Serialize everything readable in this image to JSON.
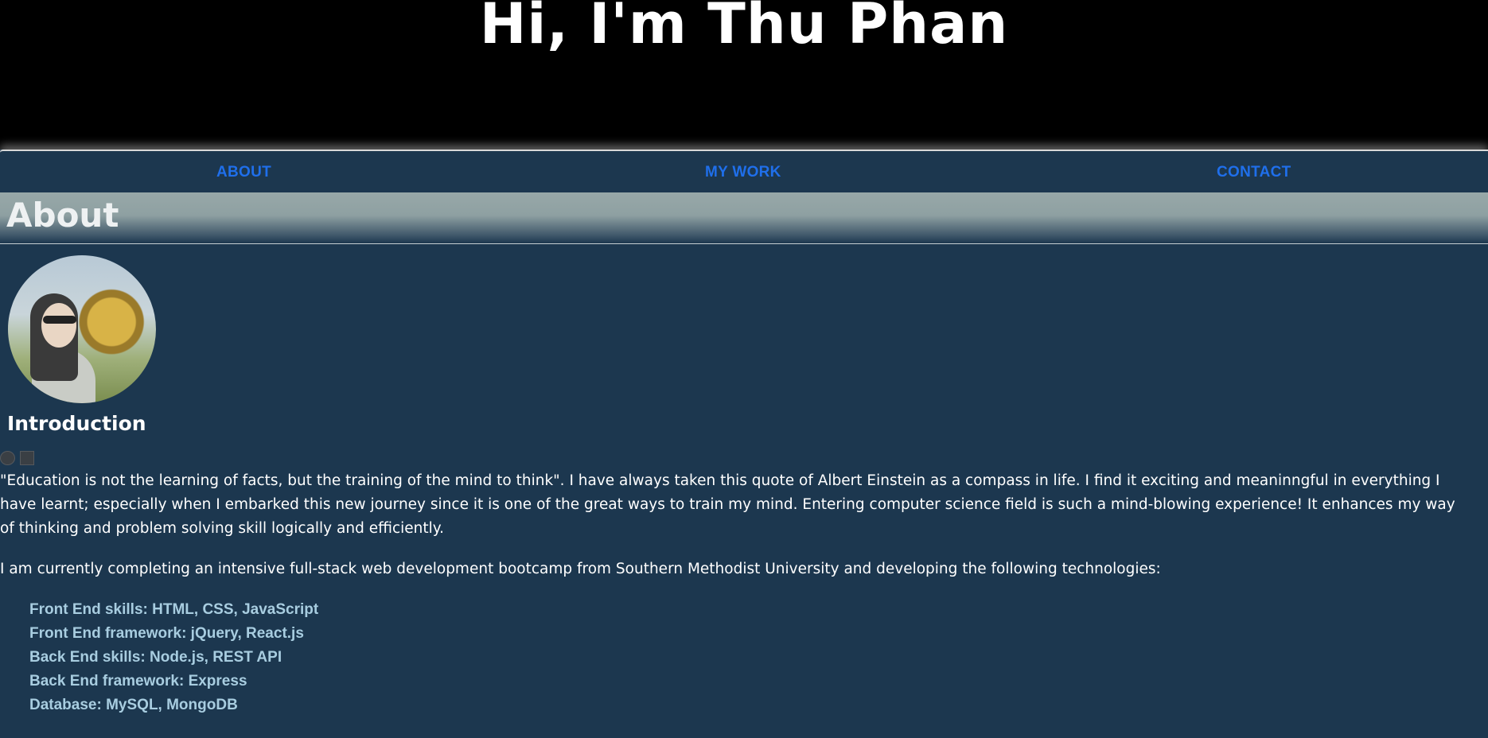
{
  "header": {
    "title": "Hi, I'm Thu Phan"
  },
  "nav": {
    "items": [
      {
        "label": "ABOUT"
      },
      {
        "label": "MY WORK"
      },
      {
        "label": "CONTACT"
      }
    ],
    "link_color": "#1f6feb"
  },
  "about": {
    "section_title": "About",
    "intro_heading": "Introduction",
    "paragraph1": "\"Education is not the learning of facts, but the training of the mind to think\". I have always taken this quote of Albert Einstein as a compass in life. I find it exciting and meaninngful in everything I have learnt; especially when I embarked this new journey since it is one of the great ways to train my mind. Entering computer science field is such a mind-blowing experience! It enhances my way of thinking and problem solving skill logically and efficiently.",
    "paragraph2": "I am currently completing an intensive full-stack web development bootcamp from Southern Methodist University and developing the following technologies:",
    "skills": [
      "Front End skills: HTML, CSS, JavaScript",
      "Front End framework: jQuery, React.js",
      "Back End skills: Node.js, REST API",
      "Back End framework: Express",
      "Database: MySQL, MongoDB"
    ]
  },
  "colors": {
    "page_background": "#1c374f",
    "header_background": "#000000",
    "skills_text": "#a8cde0"
  }
}
